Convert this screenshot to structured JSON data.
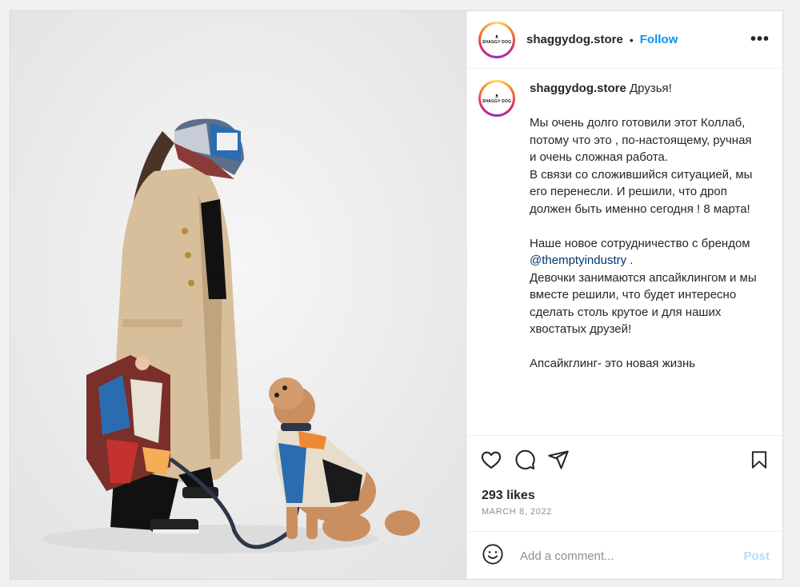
{
  "post": {
    "username": "shaggydog.store",
    "separator": "•",
    "follow_label": "Follow",
    "more_label": "•••",
    "avatar": {
      "logo_text": "SHAGGY DOG",
      "logo_mark": "ᴥ"
    },
    "caption": {
      "username": "shaggydog.store",
      "text_part1": " Друзья!\n\nМы очень долго готовили этот Коллаб, потому что это , по-настоящему, ручная и очень сложная работа.\nВ связи со сложившийся ситуацией, мы его перенесли. И решили, что дроп должен быть именно сегодня ! 8 марта!\n\nНаше новое сотрудничество с брендом ",
      "mention": "@themptyindustry",
      "text_part2": " .\nДевочки занимаются апсайклингом и мы вместе решили, что будет интересно сделать столь крутое и для наших хвостатых друзей!\n\nАпсайкглинг- это новая жизнь"
    },
    "likes": "293 likes",
    "date": "MARCH 8, 2022",
    "comment_placeholder": "Add a comment...",
    "post_label": "Post",
    "icons": [
      "heart-icon",
      "comment-icon",
      "share-icon",
      "bookmark-icon",
      "emoji-icon"
    ]
  },
  "colors": {
    "accent": "#0095f6",
    "post_disabled": "#b2dffc",
    "mention": "#00376b"
  }
}
